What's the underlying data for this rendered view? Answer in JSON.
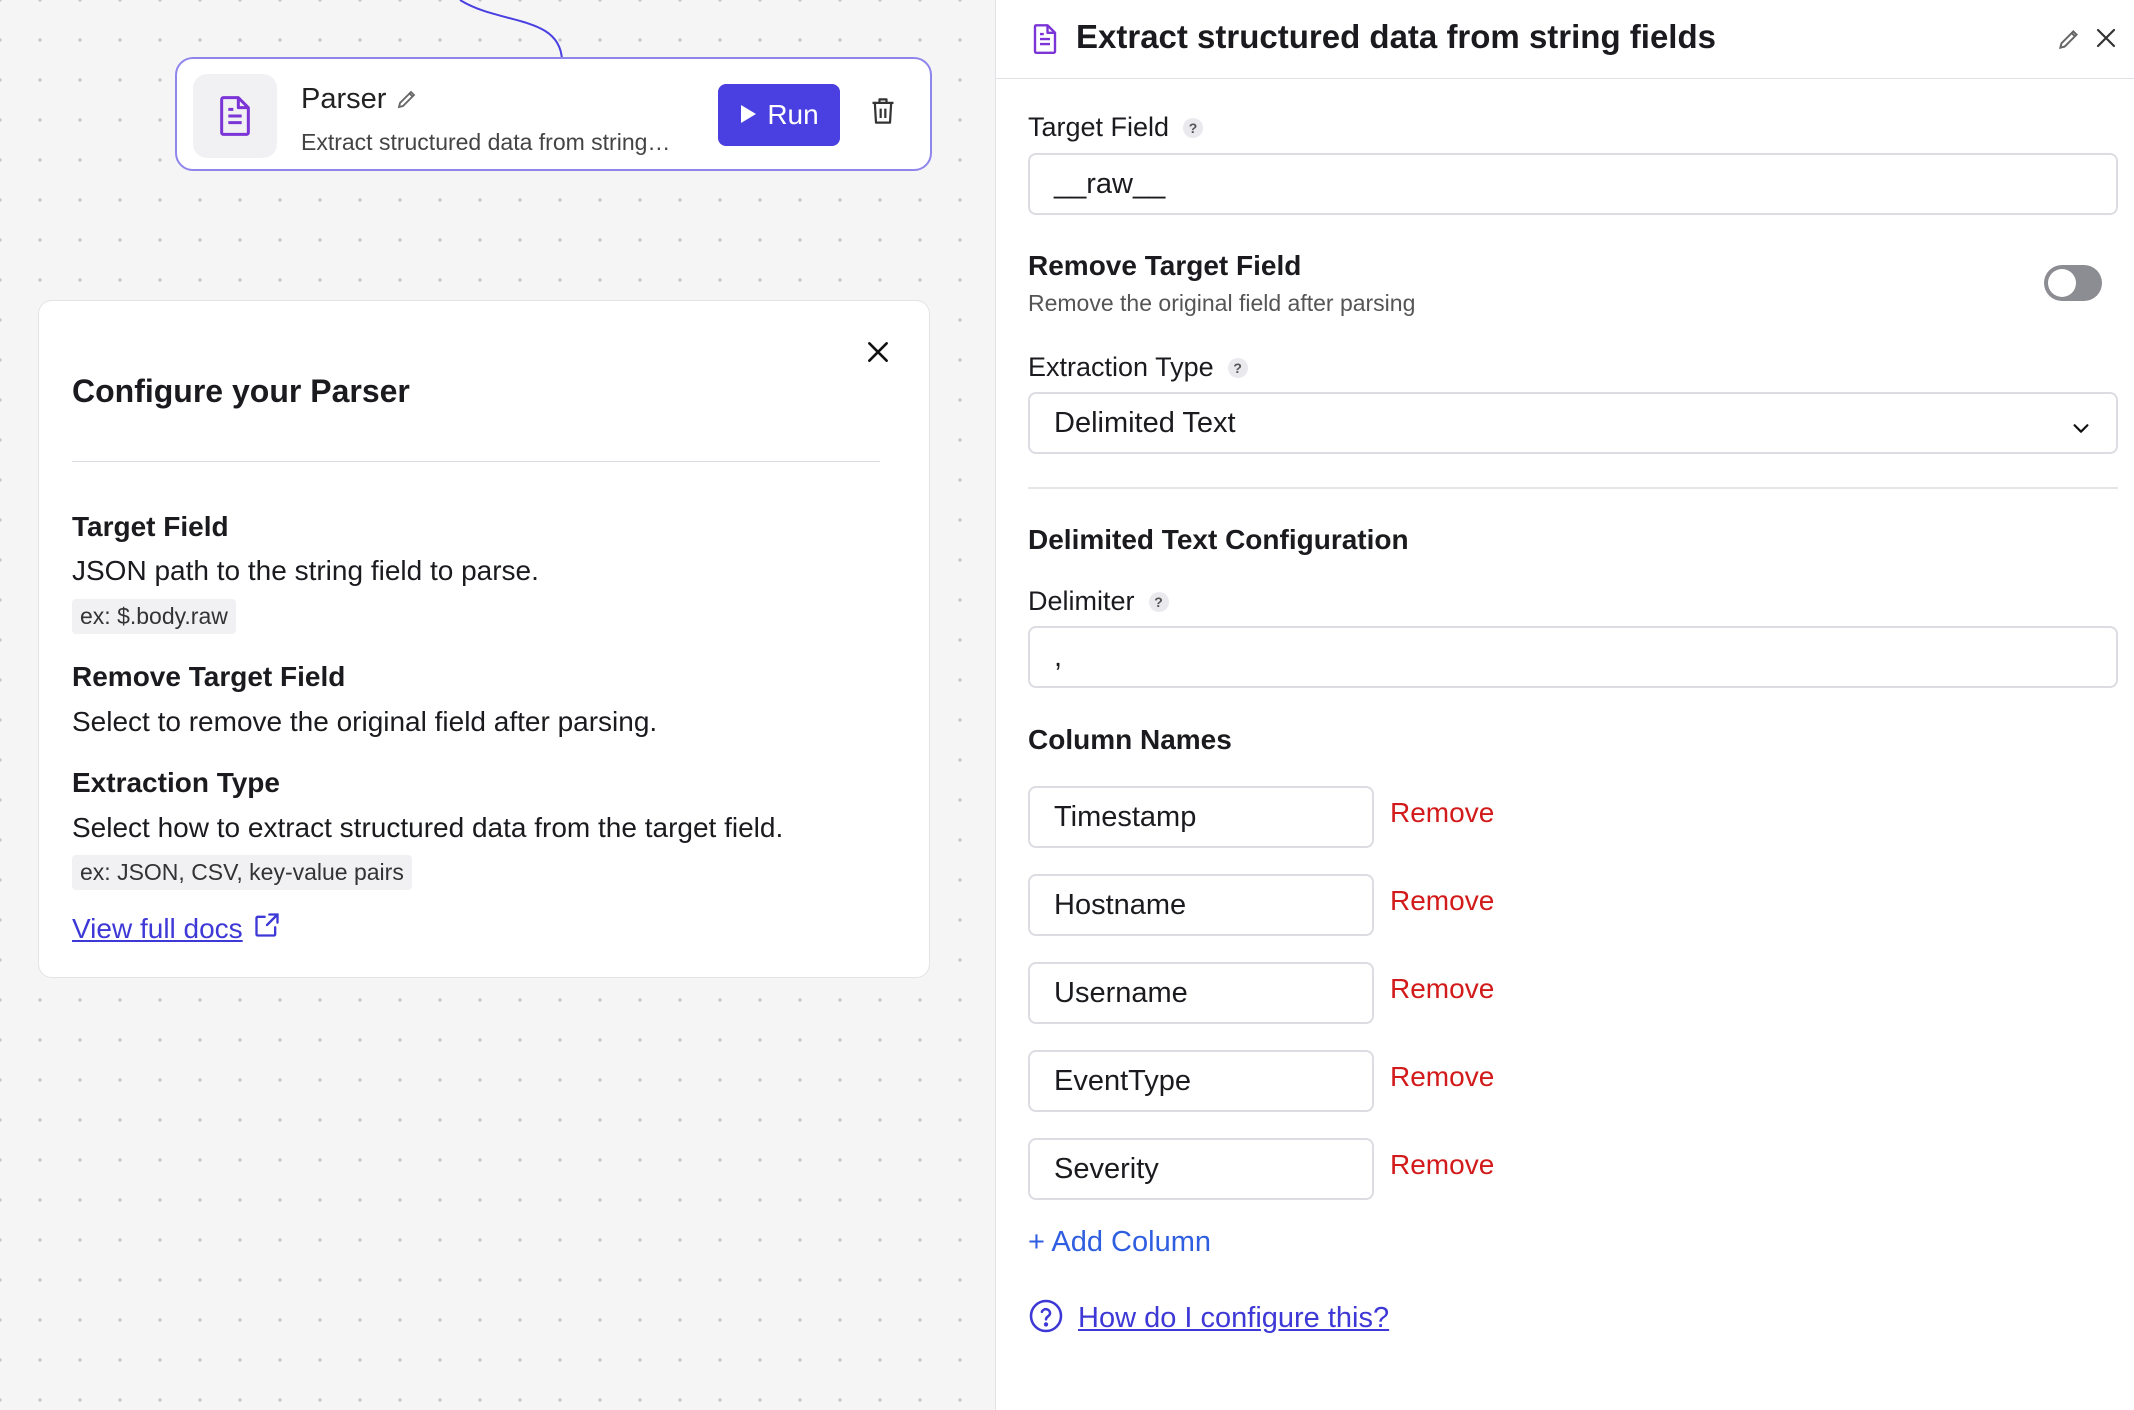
{
  "node": {
    "title": "Parser",
    "description": "Extract structured data from string…",
    "run_label": "Run"
  },
  "help": {
    "title": "Configure your Parser",
    "items": [
      {
        "heading": "Target Field",
        "text": "JSON path to the string field to parse.",
        "example": "ex: $.body.raw"
      },
      {
        "heading": "Remove Target Field",
        "text": "Select to remove the original field after parsing.",
        "example": ""
      },
      {
        "heading": "Extraction Type",
        "text": "Select how to extract structured data from the target field.",
        "example": "ex: JSON, CSV, key-value pairs"
      }
    ],
    "docs_link": "View full docs"
  },
  "panel": {
    "title": "Extract structured data from string fields",
    "target_field": {
      "label": "Target Field",
      "value": "__raw__"
    },
    "remove_target": {
      "label": "Remove Target Field",
      "sublabel": "Remove the original field after parsing",
      "enabled": false
    },
    "extraction_type": {
      "label": "Extraction Type",
      "value": "Delimited Text"
    },
    "section_title": "Delimited Text Configuration",
    "delimiter": {
      "label": "Delimiter",
      "value": ","
    },
    "column_names_label": "Column Names",
    "columns": [
      "Timestamp",
      "Hostname",
      "Username",
      "EventType",
      "Severity"
    ],
    "remove_label": "Remove",
    "add_column": "+ Add Column",
    "help_link": "How do I configure this?"
  },
  "colors": {
    "accent": "#4a3fe0",
    "node_border": "#8f86ec",
    "remove": "#d21a1a",
    "link": "#3d38d6",
    "add_link": "#2f5fe0"
  }
}
